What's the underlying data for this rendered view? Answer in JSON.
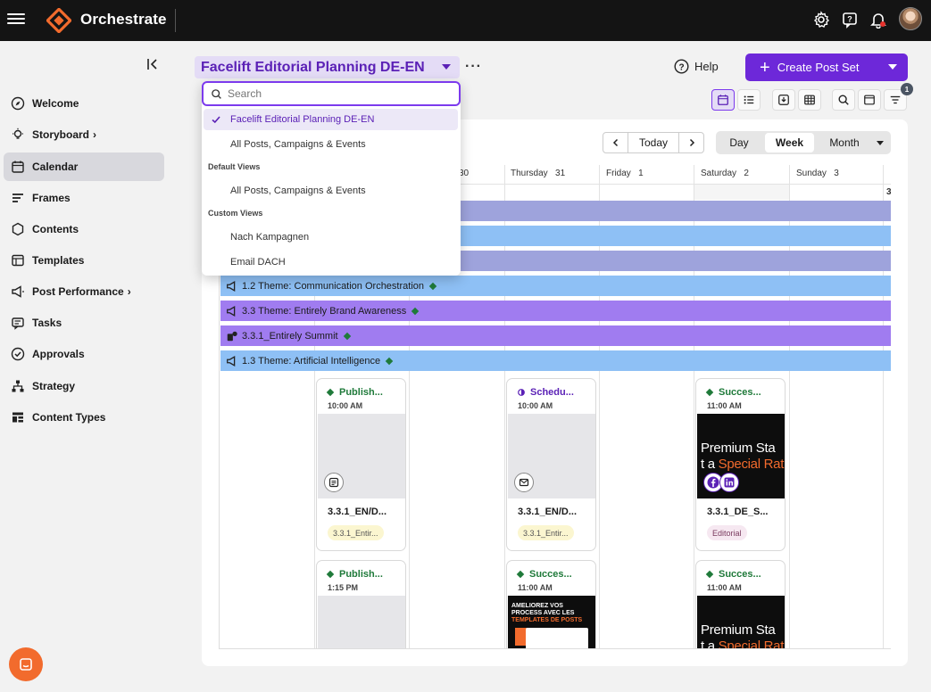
{
  "app": {
    "brand": "Orchestrate"
  },
  "sidebar": {
    "items": [
      {
        "label": "Welcome"
      },
      {
        "label": "Storyboard"
      },
      {
        "label": "Calendar"
      },
      {
        "label": "Frames"
      },
      {
        "label": "Contents"
      },
      {
        "label": "Templates"
      },
      {
        "label": "Post Performance"
      },
      {
        "label": "Tasks"
      },
      {
        "label": "Approvals"
      },
      {
        "label": "Strategy"
      },
      {
        "label": "Content Types"
      }
    ]
  },
  "header": {
    "view_title": "Facelift Editorial Planning DE-EN",
    "help_label": "Help",
    "create_label": "Create Post Set",
    "filter_count": "1"
  },
  "dropdown": {
    "search_placeholder": "Search",
    "selected": "Facelift Editorial Planning DE-EN",
    "all_posts": "All Posts, Campaigns & Events",
    "default_views_label": "Default Views",
    "default_item": "All Posts, Campaigns & Events",
    "custom_views_label": "Custom Views",
    "custom_items": [
      "Nach Kampagnen",
      "Email DACH"
    ]
  },
  "calendar": {
    "today_label": "Today",
    "views": [
      "Day",
      "Week",
      "Month"
    ],
    "active_view": "Week",
    "day_heads": [
      {
        "day": "",
        "num": "30"
      },
      {
        "day": "Thursday",
        "num": "31"
      },
      {
        "day": "Friday",
        "num": "1"
      },
      {
        "day": "Saturday",
        "num": "2"
      },
      {
        "day": "Sunday",
        "num": "3"
      }
    ],
    "next_num": "3",
    "bars": [
      {
        "label": "",
        "color": "#9ea3dc"
      },
      {
        "label": "",
        "color": "#8ec0f5"
      },
      {
        "label": "",
        "color": "#9ea3dc"
      },
      {
        "label": "1.2 Theme: Communication Orchestration",
        "color": "#8ec0f5"
      },
      {
        "label": "3.3 Theme: Entirely Brand Awareness",
        "color": "#a07cf0"
      },
      {
        "label": "3.3.1_Entirely Summit",
        "color": "#a07cf0"
      },
      {
        "label": "1.3 Theme: Artificial Intelligence",
        "color": "#8ec0f5"
      }
    ],
    "cards": [
      {
        "status": "Publish...",
        "time": "10:00 AM",
        "title": "3.3.1_EN/D...",
        "tag": "3.3.1_Entir..."
      },
      {
        "status": "Schedu...",
        "time": "10:00 AM",
        "title": "3.3.1_EN/D...",
        "tag": "3.3.1_Entir..."
      },
      {
        "status": "Succes...",
        "time": "11:00 AM",
        "title": "3.3.1_DE_S...",
        "tag": "Editorial",
        "promo_line1": "Premium Sta",
        "promo_line2a": "t a ",
        "promo_line2b": "Special Rat"
      },
      {
        "status": "Publish...",
        "time": "1:15 PM"
      },
      {
        "status": "Succes...",
        "time": "11:00 AM",
        "promo_text1": "AMELIOREZ VOS",
        "promo_text2": "PROCESS AVEC LES",
        "promo_text3": "TEMPLATES DE POSTS"
      },
      {
        "status": "Succes...",
        "time": "11:00 AM",
        "promo_line1": "Premium Sta",
        "promo_line2a": "t a ",
        "promo_line2b": "Special Rat"
      }
    ]
  },
  "colors": {
    "accent": "#6d28d9",
    "status_published": "#1f7a3a",
    "status_scheduled": "#5b21b6",
    "brand_orange": "#f26b2d"
  }
}
